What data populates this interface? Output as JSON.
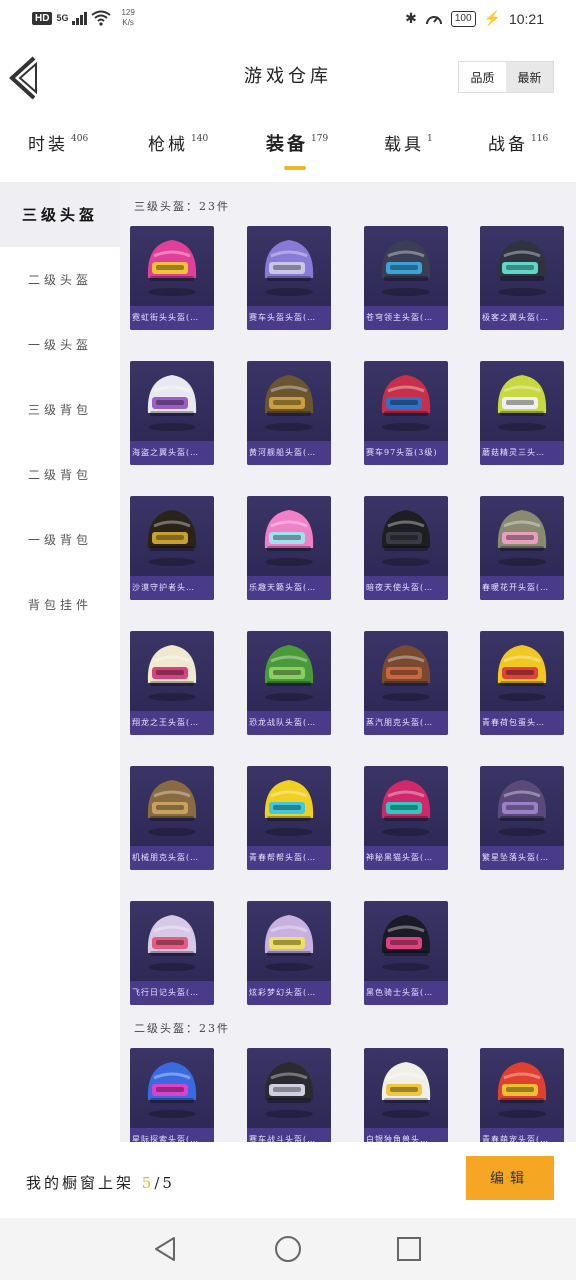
{
  "status": {
    "hd": "HD",
    "network": "5G",
    "speed_top": "129",
    "speed_bottom": "K/s",
    "battery": "100",
    "time": "10:21"
  },
  "header": {
    "title": "游戏仓库",
    "sort_quality": "品质",
    "sort_newest": "最新"
  },
  "tabs": [
    {
      "label": "时装",
      "count": "406"
    },
    {
      "label": "枪械",
      "count": "140"
    },
    {
      "label": "装备",
      "count": "179"
    },
    {
      "label": "载具",
      "count": "1"
    },
    {
      "label": "战备",
      "count": "116"
    }
  ],
  "sidebar": [
    "三级头盔",
    "二级头盔",
    "一级头盔",
    "三级背包",
    "二级背包",
    "一级背包",
    "背包挂件"
  ],
  "sections": [
    {
      "label": "三级头盔：23件"
    },
    {
      "label": "二级头盔：23件"
    }
  ],
  "items": [
    {
      "name": "霓虹街头头盔(…",
      "color": "#e0409a",
      "accent": "#f2c23a"
    },
    {
      "name": "赛车头盔头盔(…",
      "color": "#8a7ad8",
      "accent": "#c9c6e8"
    },
    {
      "name": "苍穹领主头盔(…",
      "color": "#3b3f55",
      "accent": "#3da2d8"
    },
    {
      "name": "极客之翼头盔(…",
      "color": "#2f3340",
      "accent": "#5fd6c8"
    },
    {
      "name": "海盗之翼头盔(…",
      "color": "#e8e8f0",
      "accent": "#9a5fc7"
    },
    {
      "name": "黄河舰船头盔(…",
      "color": "#6a5530",
      "accent": "#c8a040"
    },
    {
      "name": "赛车97头盔(3级)",
      "color": "#c8304a",
      "accent": "#3070c8"
    },
    {
      "name": "蘑菇精灵三头…",
      "color": "#c8d840",
      "accent": "#f0f0f0"
    },
    {
      "name": "沙漠守护者头…",
      "color": "#2a2418",
      "accent": "#c8a030"
    },
    {
      "name": "乐趣天籁头盔(…",
      "color": "#f080c8",
      "accent": "#a0e0f0"
    },
    {
      "name": "暗夜天使头盔(…",
      "color": "#1e1e22",
      "accent": "#3a3a44"
    },
    {
      "name": "春暖花开头盔(…",
      "color": "#8a8a70",
      "accent": "#e8a0c0"
    },
    {
      "name": "翔龙之王头盔(…",
      "color": "#f0e8d0",
      "accent": "#d84080"
    },
    {
      "name": "恐龙战队头盔(…",
      "color": "#4a9a3a",
      "accent": "#88d060"
    },
    {
      "name": "蒸汽朋克头盔(…",
      "color": "#7a4a30",
      "accent": "#c86840"
    },
    {
      "name": "青春荷包蛋头…",
      "color": "#f0c820",
      "accent": "#e04040"
    },
    {
      "name": "机械朋克头盔(…",
      "color": "#8a6a40",
      "accent": "#c8a060"
    },
    {
      "name": "青春帮帮头盔(…",
      "color": "#f0d020",
      "accent": "#40c8e0"
    },
    {
      "name": "神秘黑猫头盔(…",
      "color": "#d02868",
      "accent": "#30c8c0"
    },
    {
      "name": "繁星坠落头盔(…",
      "color": "#5a4a7a",
      "accent": "#9a80c8"
    },
    {
      "name": "飞行日记头盔(…",
      "color": "#d8c8e8",
      "accent": "#e85a80"
    },
    {
      "name": "炫彩梦幻头盔(…",
      "color": "#c8b0e0",
      "accent": "#f0e060"
    },
    {
      "name": "黑色骑士头盔(…",
      "color": "#1a1a28",
      "accent": "#e04080"
    },
    {
      "name": "星际探索头盔(…",
      "color": "#3a6ae0",
      "accent": "#e040c8"
    },
    {
      "name": "赛车战斗头盔(…",
      "color": "#2a2a30",
      "accent": "#d0d0e0"
    },
    {
      "name": "白银独角兽头…",
      "color": "#f0f0e8",
      "accent": "#f0c840"
    },
    {
      "name": "青春萌宠头盔(…",
      "color": "#e04030",
      "accent": "#f0c030"
    }
  ],
  "bottom": {
    "showcase_text": "我的橱窗上架",
    "showcase_count": "5",
    "showcase_total": "/5",
    "edit_label": "编辑"
  }
}
